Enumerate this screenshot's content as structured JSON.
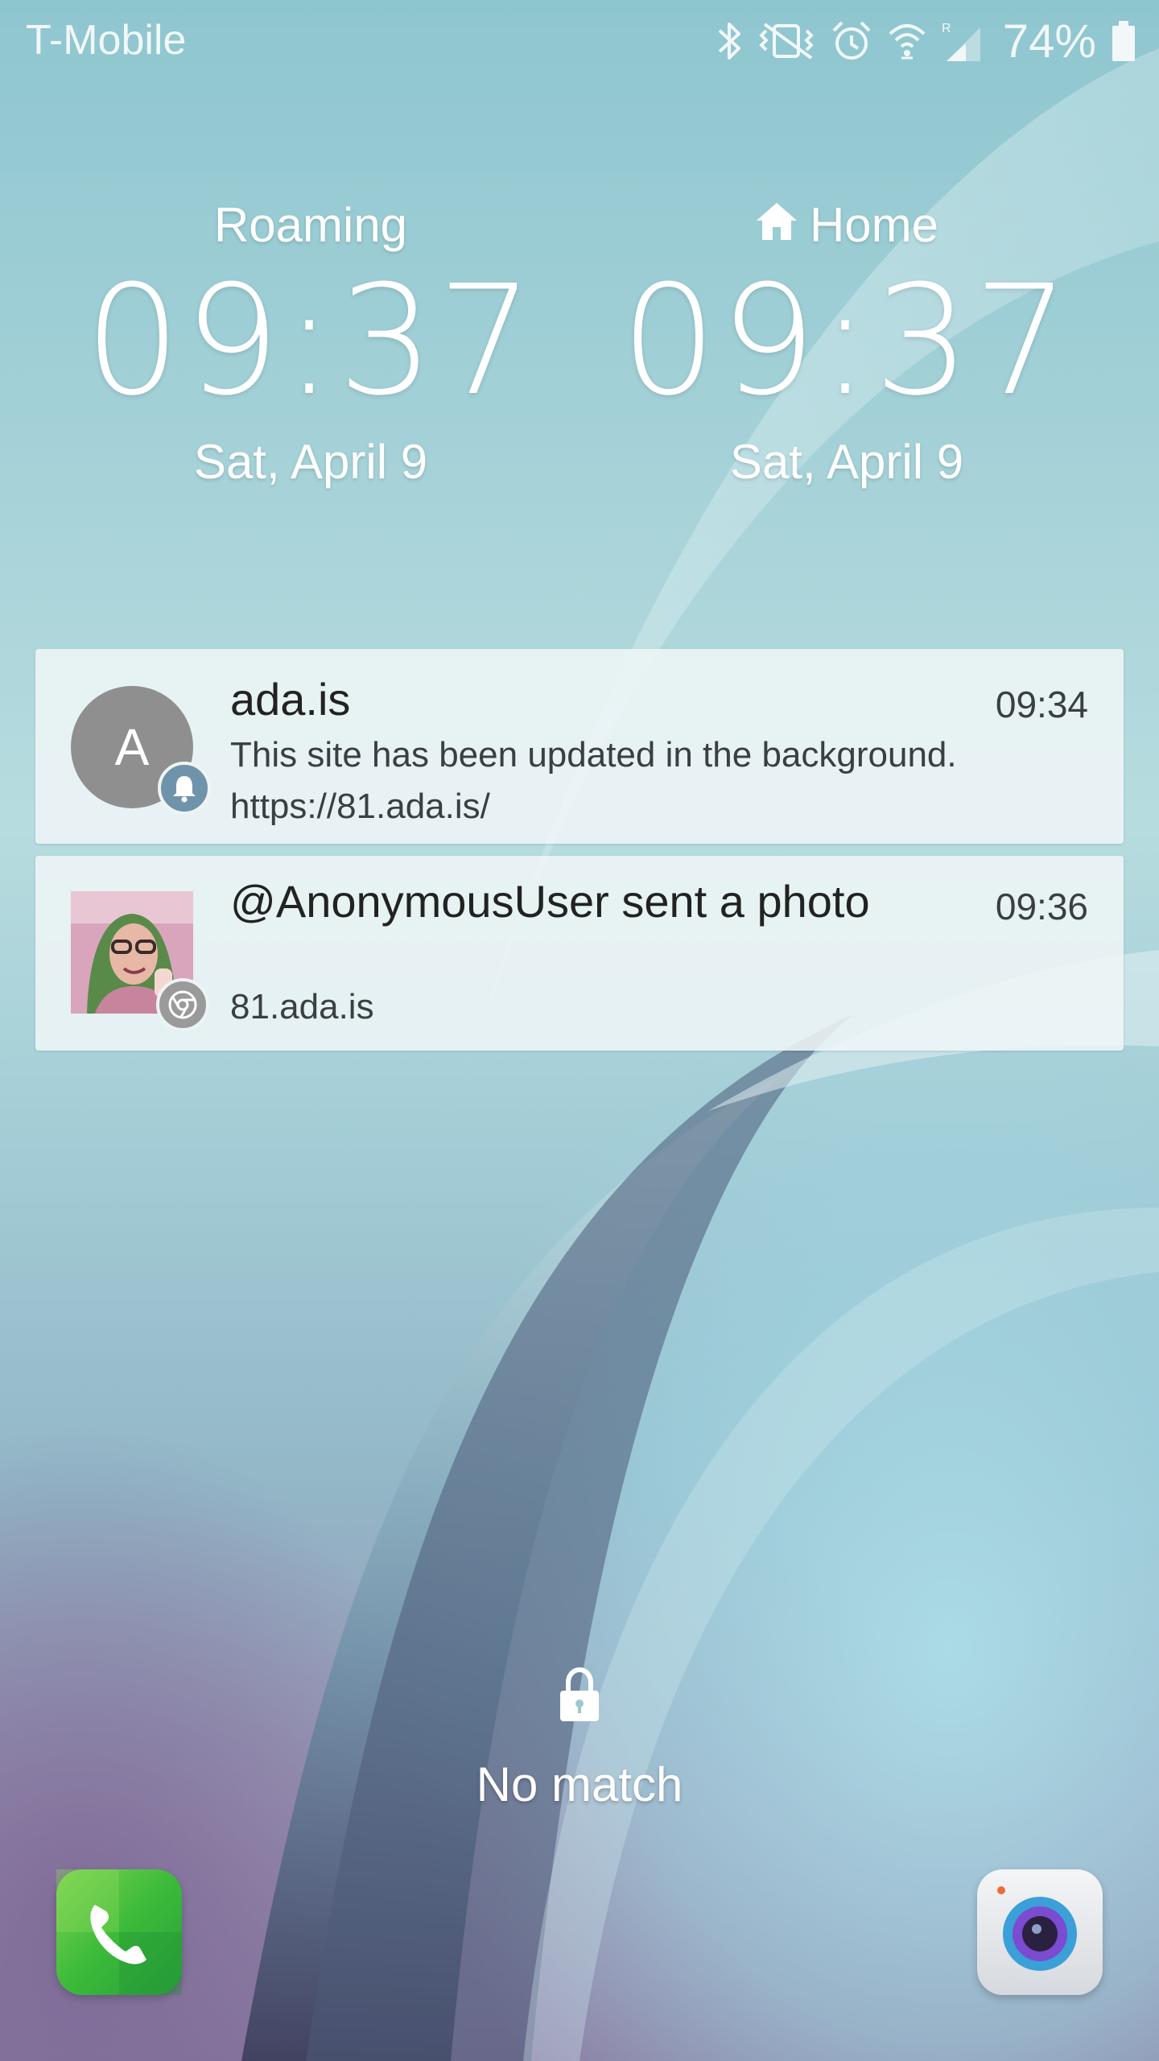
{
  "status_bar": {
    "carrier": "T-Mobile",
    "battery_percent": "74%",
    "icons": [
      "bluetooth-icon",
      "vibrate-icon",
      "alarm-icon",
      "wifi-icon",
      "roaming-signal-icon",
      "battery-icon"
    ]
  },
  "clocks": [
    {
      "label": "Roaming",
      "time": "09:37",
      "date": "Sat, April 9"
    },
    {
      "label": "Home",
      "time": "09:37",
      "date": "Sat, April 9",
      "icon": "home-icon"
    }
  ],
  "notifications": [
    {
      "avatar_letter": "A",
      "title": "ada.is",
      "time": "09:34",
      "text": "This site has been updated in the background.",
      "subtext": "https://81.ada.is/",
      "badge_icon": "bell-icon"
    },
    {
      "title": "@AnonymousUser sent a photo",
      "time": "09:36",
      "subtext": "81.ada.is",
      "badge_icon": "chrome-icon"
    }
  ],
  "lock": {
    "status": "No match",
    "icon": "lock-icon"
  },
  "shortcuts": {
    "left": "phone-icon",
    "right": "camera-icon"
  },
  "colors": {
    "notification_bg": "#f0f6f7",
    "avatar_gray": "#8f8f8f",
    "badge_blue": "#6f93ab",
    "phone_green": "#3cba3a"
  }
}
